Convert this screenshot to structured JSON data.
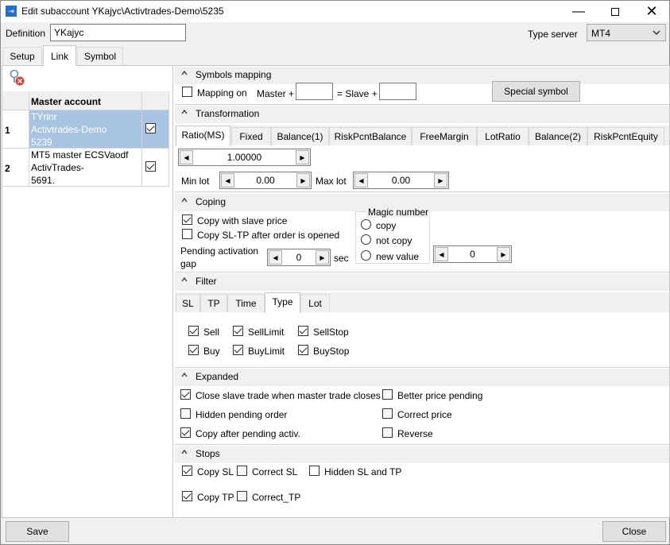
{
  "window": {
    "title": "Edit subaccount YKajyc\\Activtrades-Demo\\5235",
    "app_icon": "link-icon"
  },
  "definition": {
    "label": "Definition",
    "value": "YKajyc"
  },
  "type_server": {
    "label": "Type server",
    "value": "MT4"
  },
  "tabs": [
    {
      "label": "Setup"
    },
    {
      "label": "Link"
    },
    {
      "label": "Symbol"
    }
  ],
  "master_table": {
    "header": "Master account",
    "rows": [
      {
        "num": "1",
        "line1": "TYrlnr",
        "line2": "Activtrades-Demo",
        "line3": "5239",
        "checked": true
      },
      {
        "num": "2",
        "line1": "MT5 master ECSVaodf",
        "line2": "ActivTrades-",
        "line3": "5691.",
        "checked": true
      }
    ]
  },
  "symbols_mapping": {
    "title": "Symbols mapping",
    "mapping_on": "Mapping on",
    "master": "Master +",
    "master_value": "",
    "equals_slave": "= Slave +",
    "slave_value": "",
    "special": "Special symbol"
  },
  "transformation": {
    "title": "Transformation",
    "tabs": [
      "Ratio(MS)",
      "Fixed",
      "Balance(1)",
      "RiskPcntBalance",
      "FreeMargin",
      "LotRatio",
      "Balance(2)",
      "RiskPcntEquity"
    ],
    "ratio": "1.00000",
    "min_lot_label": "Min lot",
    "min_lot": "0.00",
    "max_lot_label": "Max lot",
    "max_lot": "0.00"
  },
  "coping": {
    "title": "Coping",
    "copy_slave_price": "Copy with slave price",
    "copy_sltp": "Copy SL-TP after order is opened",
    "pending_label_1": "Pending activation",
    "pending_label_2": "gap",
    "pending_value": "0",
    "sec": "sec",
    "magic_title": "Magic number",
    "magic_options": [
      "copy",
      "not copy",
      "new value"
    ],
    "magic_value": "0"
  },
  "filter": {
    "title": "Filter",
    "tabs": [
      "SL",
      "TP",
      "Time",
      "Type",
      "Lot"
    ],
    "sell": "Sell",
    "sell_limit": "SellLimit",
    "sell_stop": "SellStop",
    "buy": "Buy",
    "buy_limit": "BuyLimit",
    "buy_stop": "BuyStop"
  },
  "expanded": {
    "title": "Expanded",
    "close_slave": "Close slave trade when master trade closes",
    "better_price": "Better price pending",
    "hidden_pending": "Hidden pending order",
    "correct_price": "Correct price",
    "copy_after": "Copy after pending activ.",
    "reverse": "Reverse"
  },
  "stops": {
    "title": "Stops",
    "copy_sl": "Copy SL",
    "correct_sl": "Correct SL",
    "hidden_sltp": "Hidden SL and TP",
    "copy_tp": "Copy TP",
    "correct_tp": "Correct_TP"
  },
  "footer": {
    "save": "Save",
    "close": "Close"
  }
}
